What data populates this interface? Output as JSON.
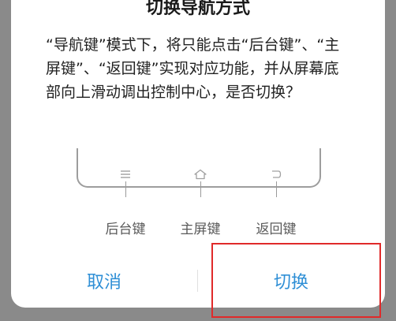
{
  "dialog": {
    "title": "切换导航方式",
    "message": "“导航键”模式下，将只能点击“后台键”、“主屏键”、“返回键”实现对应功能，并从屏幕底部向上滑动调出控制中心，是否切换？",
    "nav_keys": [
      {
        "icon": "menu-icon",
        "label": "后台键"
      },
      {
        "icon": "home-icon",
        "label": "主屏键"
      },
      {
        "icon": "back-icon",
        "label": "返回键"
      }
    ],
    "cancel_label": "取消",
    "switch_label": "切换"
  },
  "colors": {
    "accent": "#2f8fd6",
    "highlight": "#e02a2a",
    "overlay": "#8a8a8a"
  }
}
